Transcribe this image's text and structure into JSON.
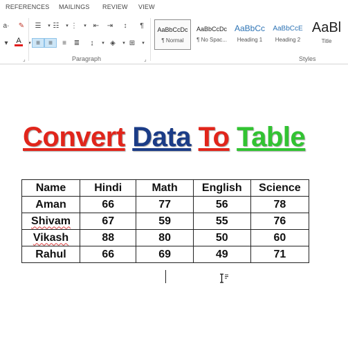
{
  "ribbon_tabs": [
    "REFERENCES",
    "MAILINGS",
    "REVIEW",
    "VIEW"
  ],
  "ribbon": {
    "paragraph_group_label": "Paragraph",
    "styles_group_label": "Styles",
    "styles": [
      {
        "sample": "AaBbCcDc",
        "name": "¶ Normal",
        "selected": true
      },
      {
        "sample": "AaBbCcDc",
        "name": "¶ No Spac...",
        "selected": false
      },
      {
        "sample": "AaBbCc",
        "name": "Heading 1",
        "selected": false
      },
      {
        "sample": "AaBbCcE",
        "name": "Heading 2",
        "selected": false
      },
      {
        "sample": "AaBl",
        "name": "Title",
        "selected": false
      }
    ],
    "icons": {
      "font_color_letter": "A"
    }
  },
  "document": {
    "title_words": [
      {
        "text": "Convert",
        "color": "#e1251b"
      },
      {
        "text": "Data",
        "color": "#1b3c87"
      },
      {
        "text": "To",
        "color": "#e1251b"
      },
      {
        "text": "Table",
        "color": "#32c332"
      }
    ],
    "table": {
      "headers": [
        "Name",
        "Hindi",
        "Math",
        "English",
        "Science"
      ],
      "rows": [
        [
          "Aman",
          "66",
          "77",
          "56",
          "78"
        ],
        [
          "Shivam",
          "67",
          "59",
          "55",
          "76"
        ],
        [
          "Vikash",
          "88",
          "80",
          "50",
          "60"
        ],
        [
          "Rahul",
          "66",
          "69",
          "49",
          "71"
        ]
      ]
    }
  },
  "colors": {
    "accent": "#2b579a",
    "spell_underline": "#d93b3b"
  }
}
